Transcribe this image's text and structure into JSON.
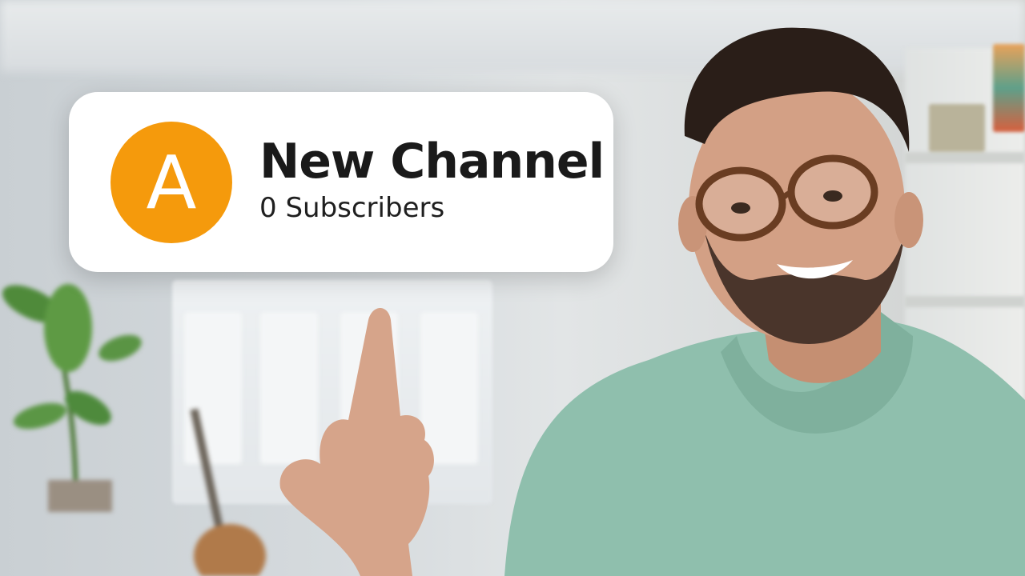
{
  "channel_card": {
    "avatar_letter": "A",
    "name": "New Channel",
    "subscribers": "0 Subscribers",
    "avatar_color": "#f59a0c"
  },
  "scene": {
    "hoodie_color": "#8fbfad",
    "background_color": "#d6dbde"
  }
}
